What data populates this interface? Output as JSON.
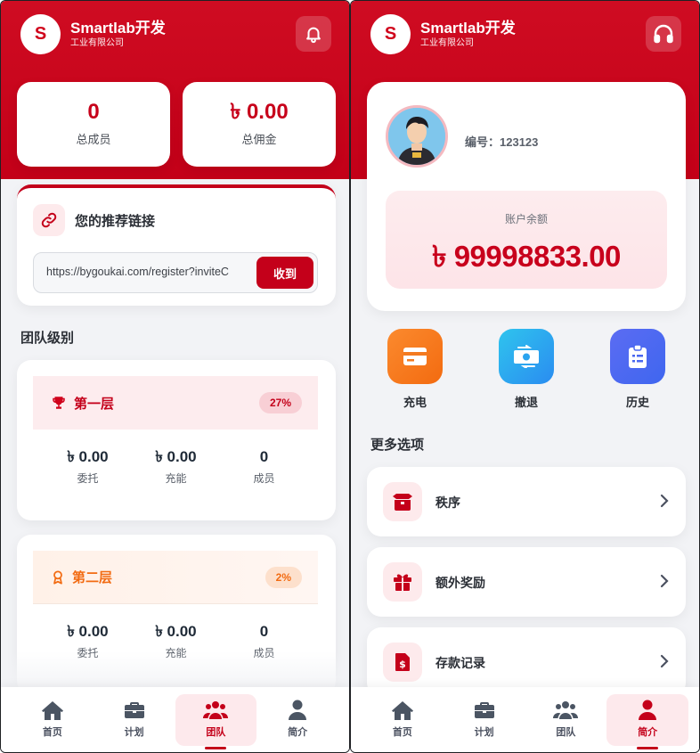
{
  "brand": {
    "logo_letter": "S",
    "name": "Smartlab开发",
    "subtitle": "工业有限公司"
  },
  "colors": {
    "primary": "#c4001a",
    "accent_orange": "#f26b12",
    "tint": "#fdeaec"
  },
  "left_screen": {
    "header_icon": "bell-icon",
    "stats": [
      {
        "value": "0",
        "label": "总成员"
      },
      {
        "value": "৳ 0.00",
        "label": "总佣金"
      }
    ],
    "referral": {
      "title": "您的推荐链接",
      "link": "https://bygoukai.com/register?inviteC",
      "button": "收到"
    },
    "team_level_title": "团队级别",
    "tiers": [
      {
        "name": "第一层",
        "percent": "27%",
        "icon": "trophy-icon",
        "stats": [
          {
            "value": "৳ 0.00",
            "label": "委托"
          },
          {
            "value": "৳ 0.00",
            "label": "充能"
          },
          {
            "value": "0",
            "label": "成员"
          }
        ]
      },
      {
        "name": "第二层",
        "percent": "2%",
        "icon": "award-icon",
        "stats": [
          {
            "value": "৳ 0.00",
            "label": "委托"
          },
          {
            "value": "৳ 0.00",
            "label": "充能"
          },
          {
            "value": "0",
            "label": "成员"
          }
        ]
      }
    ],
    "nav": [
      {
        "label": "首页",
        "icon": "home-icon"
      },
      {
        "label": "计划",
        "icon": "briefcase-icon"
      },
      {
        "label": "团队",
        "icon": "users-icon",
        "active": true
      },
      {
        "label": "简介",
        "icon": "user-icon"
      }
    ]
  },
  "right_screen": {
    "header_icon": "headset-icon",
    "profile": {
      "id_label": "编号：123123"
    },
    "balance": {
      "label": "账户余额",
      "value": "৳ 99998833.00"
    },
    "actions": [
      {
        "label": "充电",
        "icon": "card-icon"
      },
      {
        "label": "撤退",
        "icon": "cash-exchange-icon"
      },
      {
        "label": "历史",
        "icon": "clipboard-icon"
      }
    ],
    "more_title": "更多选项",
    "menu": [
      {
        "label": "秩序",
        "icon": "box-icon"
      },
      {
        "label": "额外奖励",
        "icon": "gift-icon"
      },
      {
        "label": "存款记录",
        "icon": "invoice-icon"
      }
    ],
    "nav": [
      {
        "label": "首页",
        "icon": "home-icon"
      },
      {
        "label": "计划",
        "icon": "briefcase-icon"
      },
      {
        "label": "团队",
        "icon": "users-icon"
      },
      {
        "label": "简介",
        "icon": "user-icon",
        "active": true
      }
    ]
  }
}
